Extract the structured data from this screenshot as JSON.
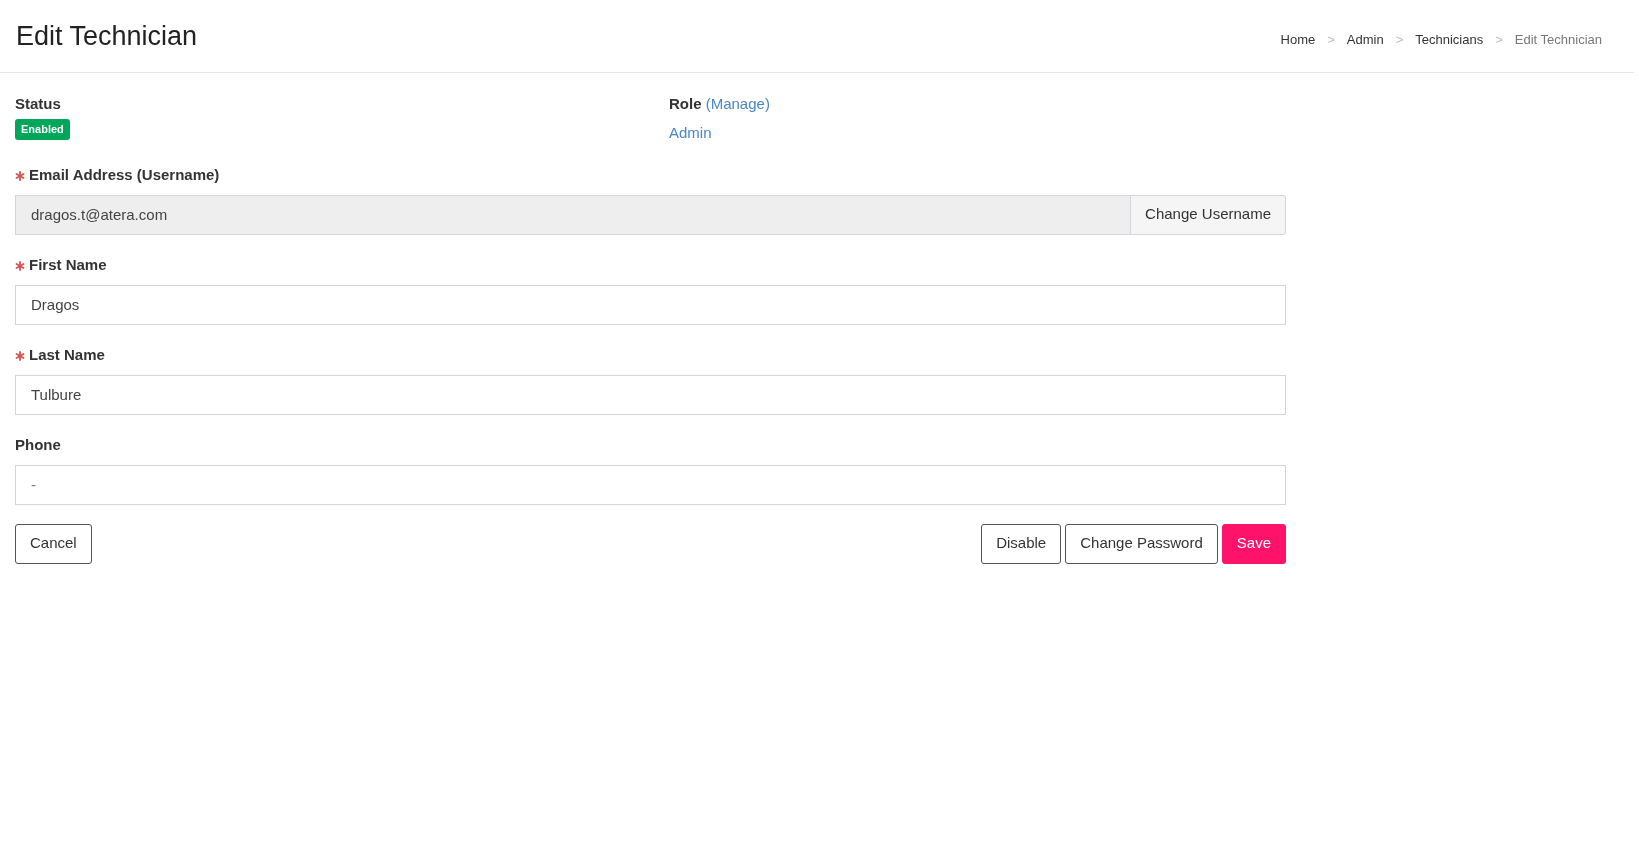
{
  "page_title": "Edit Technician",
  "breadcrumb": [
    {
      "label": "Home",
      "current": false,
      "separator": ">"
    },
    {
      "label": "Admin",
      "current": false,
      "separator": ">"
    },
    {
      "label": "Technicians",
      "current": false,
      "separator": ">"
    },
    {
      "label": "Edit Technician",
      "current": true
    }
  ],
  "status": {
    "label": "Status",
    "badge": "Enabled",
    "enabled": true
  },
  "role": {
    "label": "Role",
    "manage_link": "(Manage)",
    "value": "Admin"
  },
  "fields": [
    {
      "label": "Email Address (Username)",
      "required": true,
      "readonly": true,
      "value": "dragos.t@atera.com",
      "addon_button": "Change Username"
    },
    {
      "label": "First Name",
      "required": true,
      "readonly": false,
      "value": "Dragos"
    },
    {
      "label": "Last Name",
      "required": true,
      "readonly": false,
      "value": "Tulbure"
    },
    {
      "label": "Phone",
      "required": false,
      "readonly": false,
      "placeholder": "-"
    }
  ],
  "left_buttons": [
    {
      "label": "Cancel",
      "kind": "outline"
    }
  ],
  "right_buttons": [
    {
      "label": "Disable",
      "kind": "outline"
    },
    {
      "label": "Change Password",
      "kind": "outline"
    },
    {
      "label": "Save",
      "kind": "primary"
    }
  ]
}
